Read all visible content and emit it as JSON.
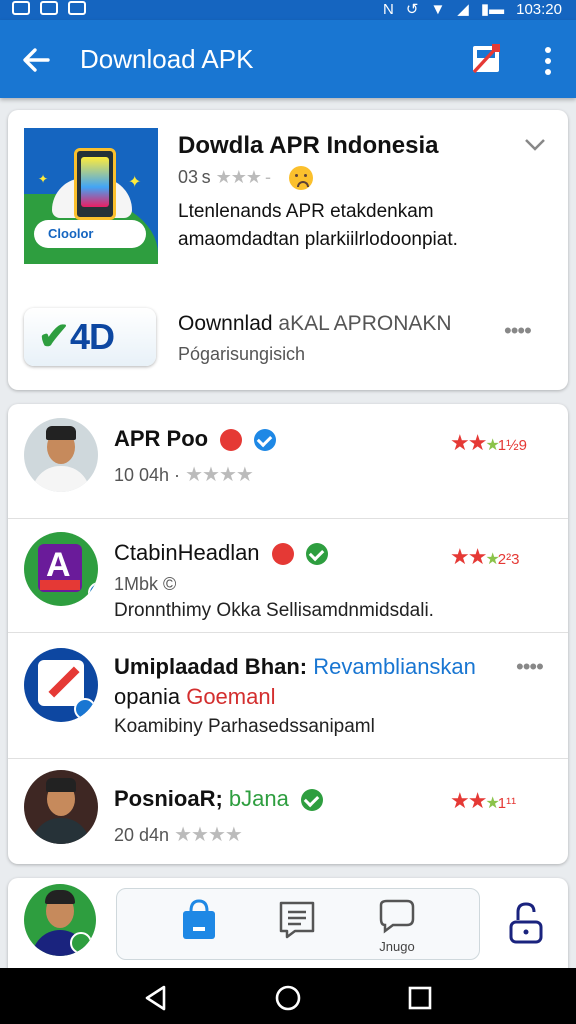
{
  "status_bar": {
    "time": "103:20"
  },
  "app_bar": {
    "title": "Download APK",
    "back_icon": "arrow-left-icon",
    "no_ads_icon": "no-ads-icon",
    "more_icon": "more-vertical-icon"
  },
  "featured": {
    "title": "Dowdla APR Indonesia",
    "meta": "03 s",
    "stars": "★★★ -",
    "description": "Ltenlenands APR etakdenkam amaomdadtan plarkiilrlodoonpiat.",
    "app_icon_label": "Cloolor",
    "download_logo_text": "4D",
    "download_title": "Oownnlad",
    "download_title_suffix": "aKAL APRONAKN",
    "download_subtitle": "Pógarisungisich",
    "menu": "••••"
  },
  "apps": [
    {
      "name": "APR Poo",
      "meta": "10 04h ·",
      "stars": "★★★★",
      "description": "",
      "rating_stars": "★★",
      "rating_extra": "★",
      "rating_num": "1½9",
      "badge": "verified-blue"
    },
    {
      "name": "CtabinHeadlan",
      "meta": "1Mbk ©",
      "stars": "",
      "description": "Dronnthimy Okka Sellisamdnmidsdali.",
      "rating_stars": "★★",
      "rating_extra": "★",
      "rating_num": "2²3",
      "badge": "verified-green"
    },
    {
      "name": "Umiplaadad Bhan:",
      "name_suffix": "Revamblianskan",
      "name_line2": "opania",
      "name_line2_suffix": "Goemanl",
      "meta": "",
      "stars": "",
      "description": "Koamibiny Parhasedssanipaml",
      "menu": "••••"
    },
    {
      "name": "PosnioaR;",
      "name_suffix": "bJana",
      "meta": "20 d4n",
      "stars": "★★★★",
      "description": "",
      "rating_stars": "★★",
      "rating_extra": "★",
      "rating_num": "1¹¹",
      "badge": "verified-green"
    }
  ],
  "bottom_tabs": [
    {
      "label": "",
      "icon": "shopping-bag-icon"
    },
    {
      "label": "",
      "icon": "message-square-icon"
    },
    {
      "label": "Jnugo",
      "icon": "chat-bubble-icon"
    }
  ],
  "colors": {
    "primary": "#1976d2",
    "status": "#1565c0",
    "accent_red": "#e53935",
    "accent_green": "#2e9e3f"
  }
}
